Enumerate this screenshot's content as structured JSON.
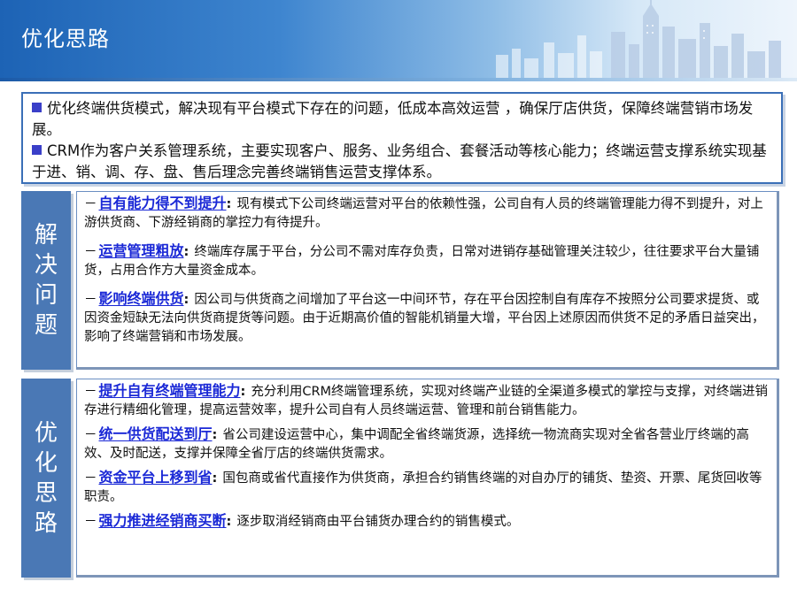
{
  "header": {
    "title": "优化思路"
  },
  "intro": {
    "items": [
      "优化终端供货模式，解决现有平台模式下存在的问题，低成本高效运营 ，确保厅店供货，保障终端营销市场发展。",
      "CRM作为客户关系管理系统，主要实现客户、服务、业务组合、套餐活动等核心能力；终端运营支撑系统实现基于进、销、调、存、盘、售后理念完善终端销售运营支撑体系。"
    ]
  },
  "sections": [
    {
      "label": "解决问题",
      "points": [
        {
          "keyword": "自有能力得不到提升",
          "text": "现有模式下公司终端运营对平台的依赖性强，公司自有人员的终端管理能力得不到提升，对上游供货商、下游经销商的掌控力有待提升。"
        },
        {
          "keyword": "运营管理粗放",
          "text": "终端库存属于平台，分公司不需对库存负责，日常对进销存基础管理关注较少，往往要求平台大量铺货，占用合作方大量资金成本。"
        },
        {
          "keyword": "影响终端供货",
          "text": "因公司与供货商之间增加了平台这一中间环节，存在平台因控制自有库存不按照分公司要求提货、或因资金短缺无法向供货商提货等问题。由于近期高价值的智能机销量大增，平台因上述原因而供货不足的矛盾日益突出，影响了终端营销和市场发展。"
        }
      ]
    },
    {
      "label": "优化思路",
      "points": [
        {
          "keyword": "提升自有终端管理能力",
          "text": "充分利用CRM终端管理系统，实现对终端产业链的全渠道多模式的掌控与支撑，对终端进销存进行精细化管理，提高运营效率，提升公司自有人员终端运营、管理和前台销售能力。"
        },
        {
          "keyword": "统一供货配送到厅",
          "text": "省公司建设运营中心，集中调配全省终端货源，选择统一物流商实现对全省各营业厅终端的高效、及时配送，支撑并保障全省厅店的终端供货需求。"
        },
        {
          "keyword": "资金平台上移到省",
          "text": "国包商或省代直接作为供货商，承担合约销售终端的对自办厅的铺货、垫资、开票、尾货回收等职责。"
        },
        {
          "keyword": "强力推进经销商买断",
          "text": "逐步取消经销商由平台铺货办理合约的销售模式。"
        }
      ]
    }
  ],
  "colors": {
    "accent_blue": "#4a78b5",
    "keyword_blue": "#1a28d6",
    "border_blue": "#3a6fb7"
  },
  "icons": {
    "skyline": "city-skyline-icon",
    "bullet": "square-bullet-icon"
  }
}
